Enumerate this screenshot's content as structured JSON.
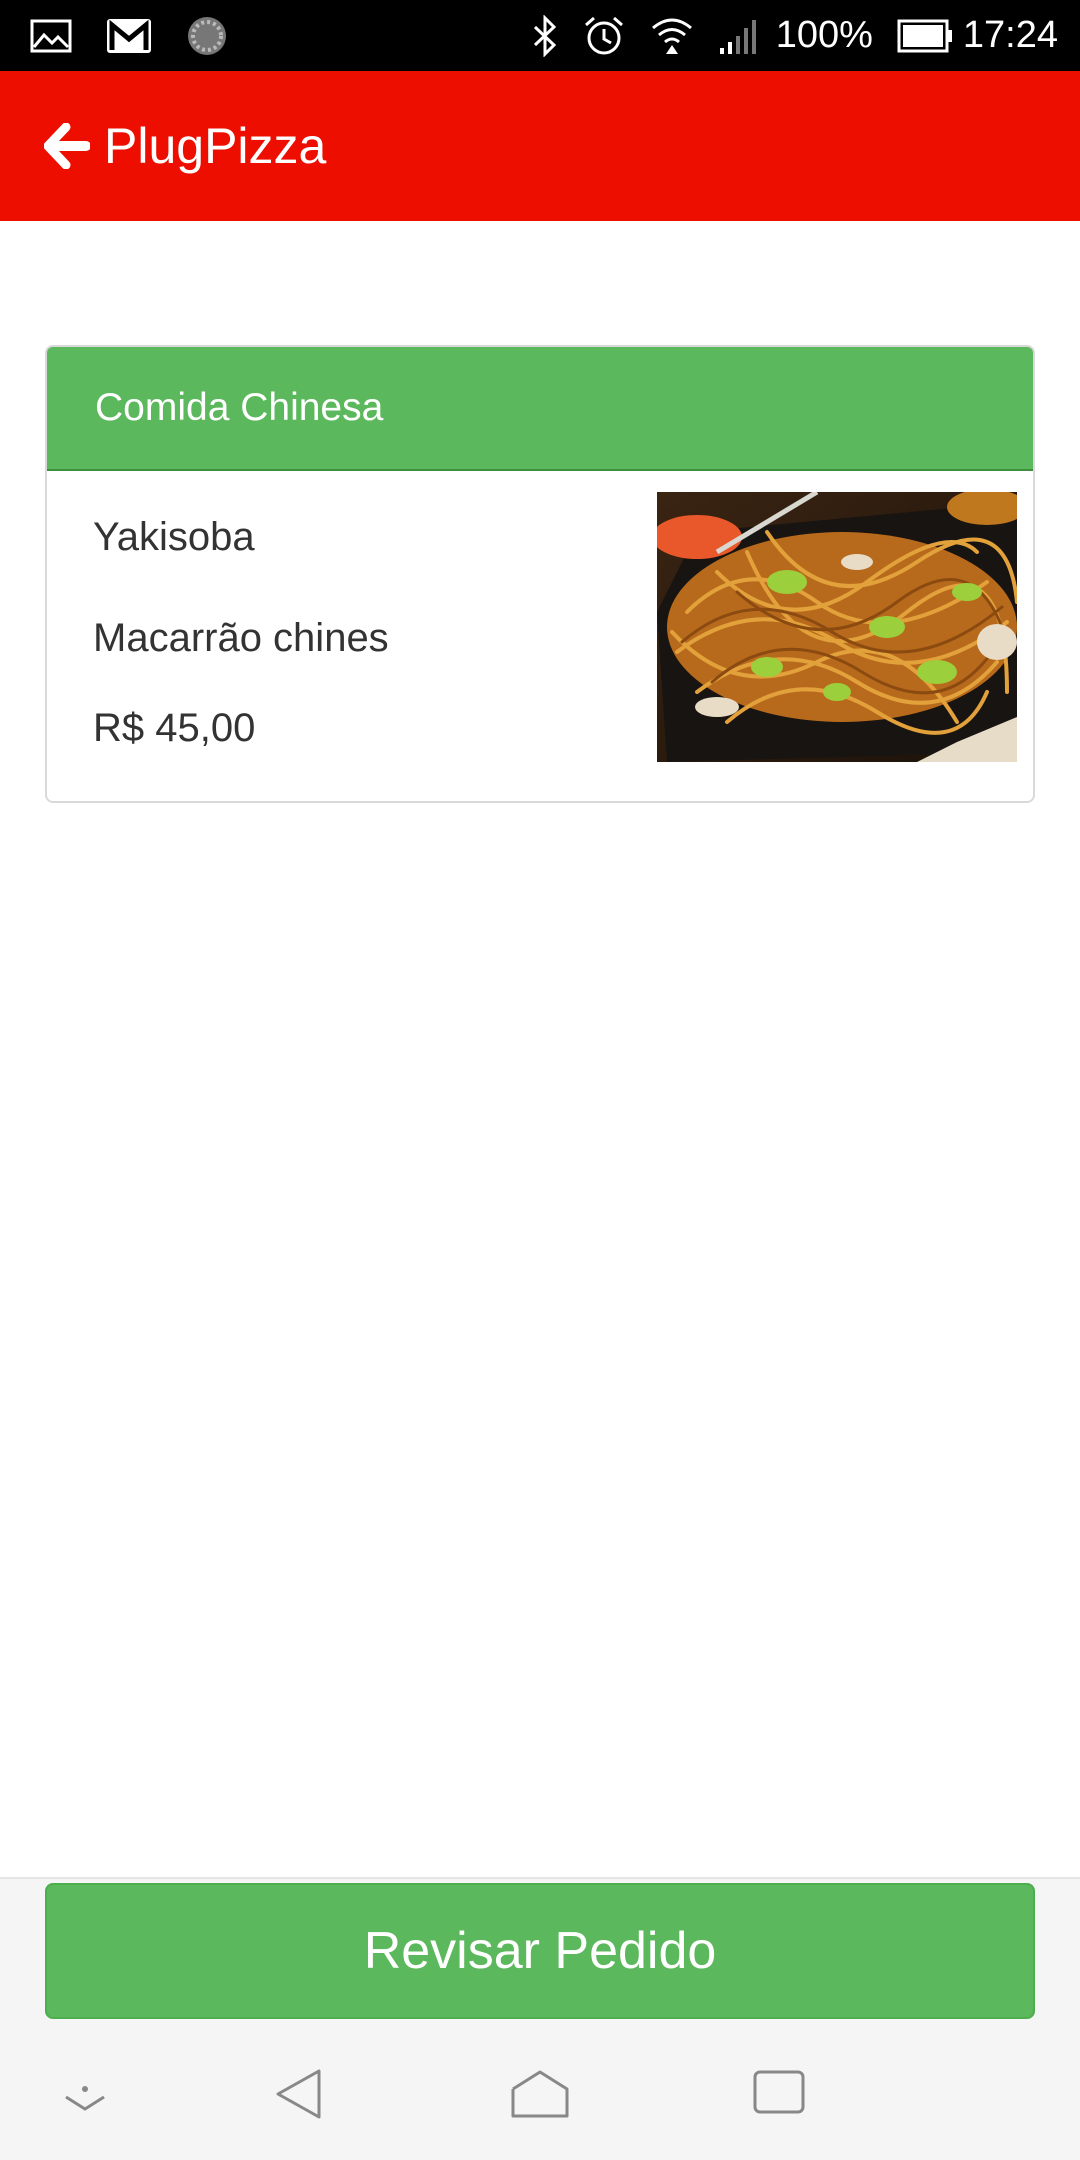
{
  "status_bar": {
    "icons": [
      "image-icon",
      "gmail-icon",
      "loading-icon",
      "bluetooth-icon",
      "alarm-icon",
      "wifi-icon",
      "signal-icon",
      "battery-icon"
    ],
    "battery": "100%",
    "time": "17:24"
  },
  "app_bar": {
    "title": "PlugPizza",
    "color": "#ee0e00"
  },
  "card": {
    "category": "Comida Chinesa",
    "item": {
      "name": "Yakisoba",
      "description": "Macarrão chines",
      "price": "R$ 45,00",
      "image": "yakisoba-noodles-photo"
    },
    "header_color": "#5cb85c"
  },
  "actions": {
    "review_label": "Revisar Pedido"
  },
  "nav_bar": {
    "buttons": [
      "collapse-icon",
      "back-icon",
      "home-icon",
      "recents-icon"
    ]
  }
}
